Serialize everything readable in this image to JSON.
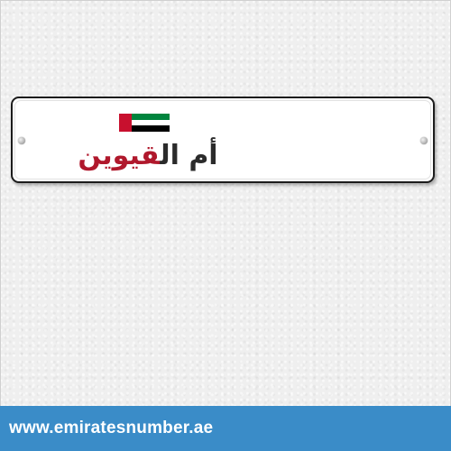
{
  "plate": {
    "emirate_name_part1": "أم ال",
    "emirate_name_part2": "قيوين",
    "flag": {
      "hoist_color": "#c8102e",
      "stripe_colors": [
        "#00843d",
        "#ffffff",
        "#000000"
      ]
    },
    "name_color": "#2b2b2b",
    "accent_color": "#b0182c"
  },
  "footer": {
    "url": "www.emiratesnumber.ae",
    "background_color": "#3a8cc8"
  }
}
